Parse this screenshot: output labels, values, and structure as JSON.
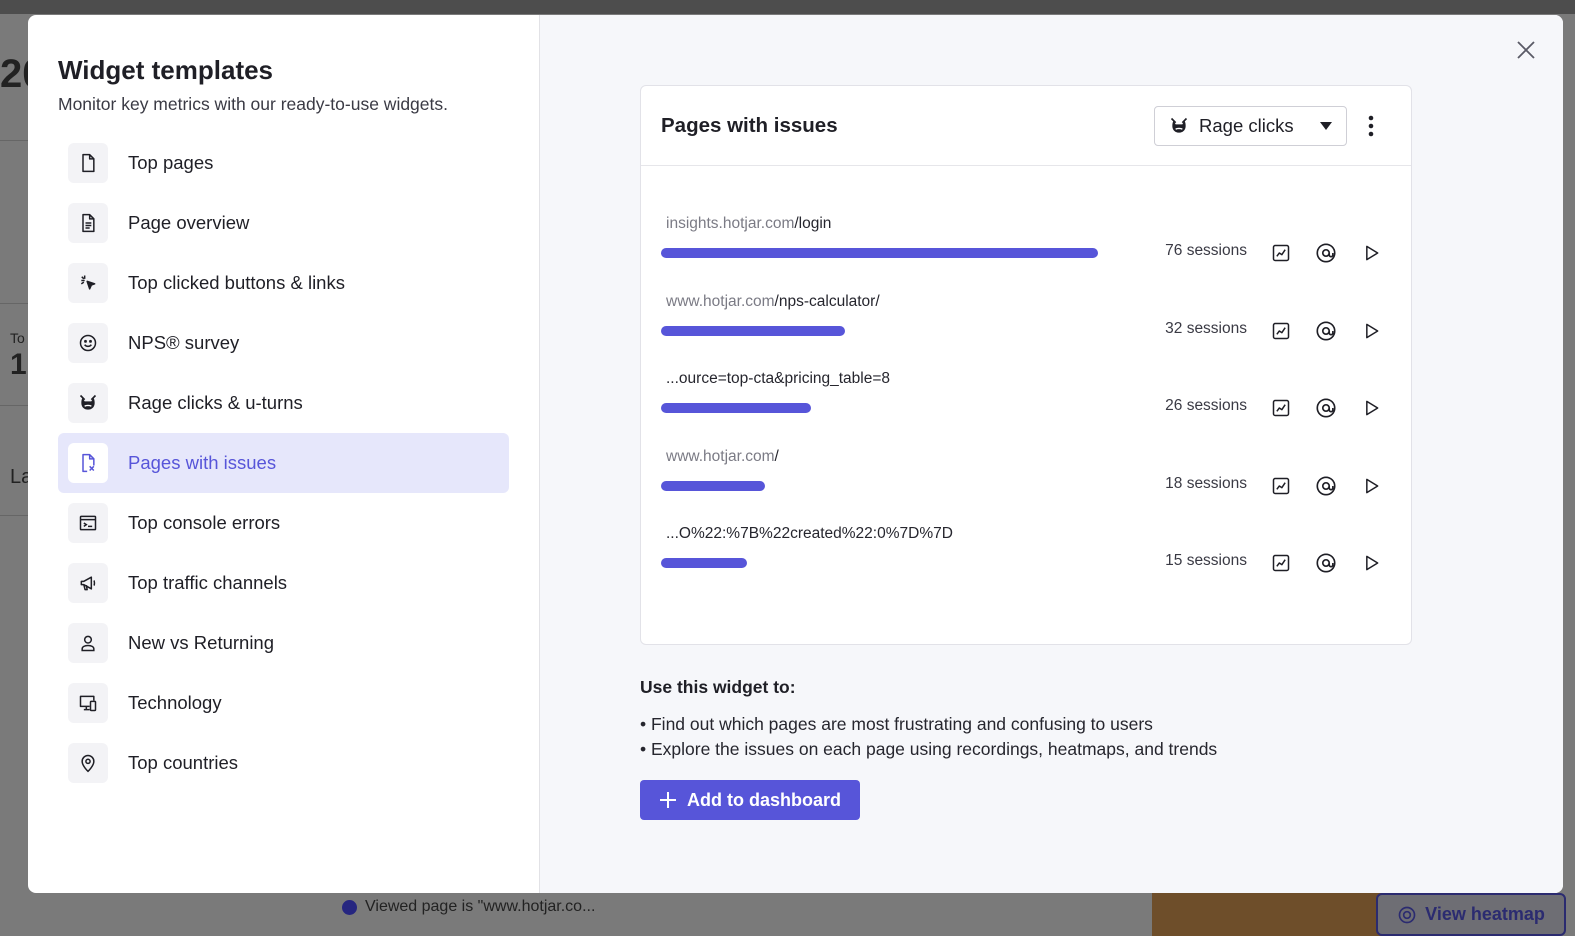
{
  "modal": {
    "title": "Widget templates",
    "subtitle": "Monitor key metrics with our ready-to-use widgets."
  },
  "templates": [
    {
      "label": "Top pages",
      "icon": "file-icon"
    },
    {
      "label": "Page overview",
      "icon": "file-text-icon"
    },
    {
      "label": "Top clicked buttons & links",
      "icon": "cursor-click-icon"
    },
    {
      "label": "NPS® survey",
      "icon": "smiley-icon"
    },
    {
      "label": "Rage clicks & u-turns",
      "icon": "angry-face-icon"
    },
    {
      "label": "Pages with issues",
      "icon": "file-error-icon",
      "selected": true
    },
    {
      "label": "Top console errors",
      "icon": "console-icon"
    },
    {
      "label": "Top traffic channels",
      "icon": "megaphone-icon"
    },
    {
      "label": "New vs Returning",
      "icon": "user-icon"
    },
    {
      "label": "Technology",
      "icon": "devices-icon"
    },
    {
      "label": "Top countries",
      "icon": "map-pin-icon"
    }
  ],
  "widget": {
    "title": "Pages with issues",
    "filter_label": "Rage clicks",
    "rows": [
      {
        "domain": "insights.hotjar.com",
        "path": "/login",
        "count_label": "76 sessions",
        "sessions": 76
      },
      {
        "domain": "www.hotjar.com",
        "path": "/nps-calculator/",
        "count_label": "32 sessions",
        "sessions": 32
      },
      {
        "domain": "",
        "path": "...ource=top-cta&pricing_table=8",
        "count_label": "26 sessions",
        "sessions": 26
      },
      {
        "domain": "www.hotjar.com",
        "path": "/",
        "count_label": "18 sessions",
        "sessions": 18
      },
      {
        "domain": "",
        "path": "...O%22:%7B%22created%22:0%7D%7D",
        "count_label": "15 sessions",
        "sessions": 15
      }
    ]
  },
  "usage": {
    "title": "Use this widget to:",
    "items": [
      "• Find out which pages are most frustrating and confusing to users",
      "• Explore the issues on each page using recordings, heatmaps, and trends"
    ]
  },
  "add_button_label": "Add to dashboard",
  "background": {
    "bottom_text": "Viewed page is \"www.hotjar.co...",
    "heatmap_button_label": "View heatmap",
    "frag_2": "20",
    "frag_1": "1",
    "frag_to": "To",
    "frag_la": "La"
  },
  "colors": {
    "accent": "#5755d9",
    "selected_bg": "#e6e7fb"
  }
}
